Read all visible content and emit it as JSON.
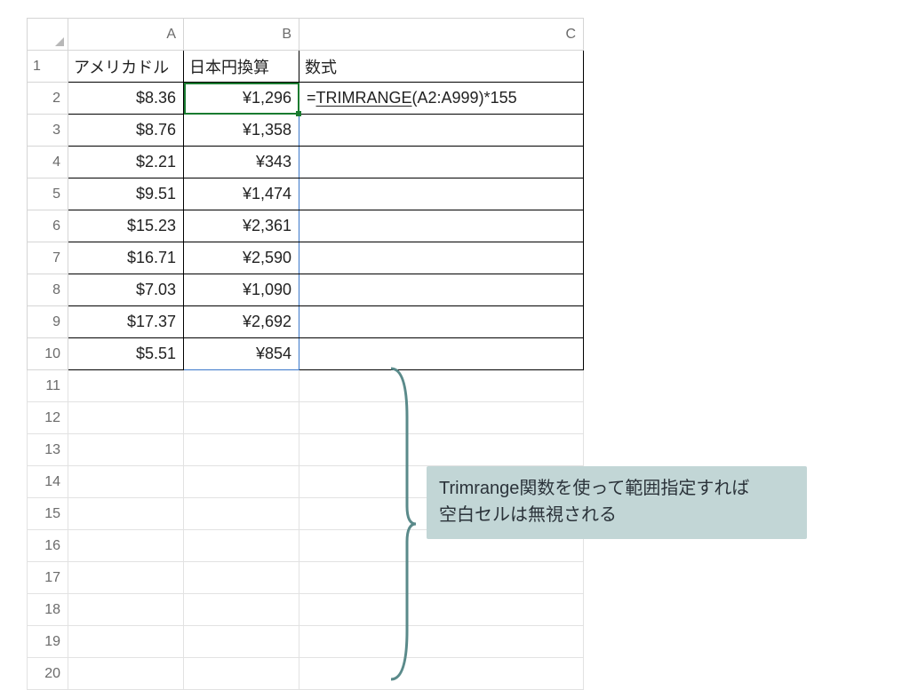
{
  "columns": {
    "A": "A",
    "B": "B",
    "C": "C"
  },
  "rowLabels": [
    "1",
    "2",
    "3",
    "4",
    "5",
    "6",
    "7",
    "8",
    "9",
    "10",
    "11",
    "12",
    "13",
    "14",
    "15",
    "16",
    "17",
    "18",
    "19",
    "20"
  ],
  "header": {
    "A": "アメリカドル",
    "B": "日本円換算",
    "C": "数式"
  },
  "rows": [
    {
      "A": "$8.36",
      "B": "¥1,296"
    },
    {
      "A": "$8.76",
      "B": "¥1,358"
    },
    {
      "A": "$2.21",
      "B": "¥343"
    },
    {
      "A": "$9.51",
      "B": "¥1,474"
    },
    {
      "A": "$15.23",
      "B": "¥2,361"
    },
    {
      "A": "$16.71",
      "B": "¥2,590"
    },
    {
      "A": "$7.03",
      "B": "¥1,090"
    },
    {
      "A": "$17.37",
      "B": "¥2,692"
    },
    {
      "A": "$5.51",
      "B": "¥854"
    }
  ],
  "formula": {
    "eq": "=",
    "fn": "TRIMRANGE",
    "args": "(A2:A999)*155"
  },
  "callout": {
    "line1": "Trimrange関数を使って範囲指定すれば",
    "line2": "空白セルは無視される"
  },
  "chart_data": {
    "type": "table",
    "columns": [
      "アメリカドル",
      "日本円換算",
      "数式"
    ],
    "data": [
      [
        "$8.36",
        "¥1,296",
        "=TRIMRANGE(A2:A999)*155"
      ],
      [
        "$8.76",
        "¥1,358",
        ""
      ],
      [
        "$2.21",
        "¥343",
        ""
      ],
      [
        "$9.51",
        "¥1,474",
        ""
      ],
      [
        "$15.23",
        "¥2,361",
        ""
      ],
      [
        "$16.71",
        "¥2,590",
        ""
      ],
      [
        "$7.03",
        "¥1,090",
        ""
      ],
      [
        "$17.37",
        "¥2,692",
        ""
      ],
      [
        "$5.51",
        "¥854",
        ""
      ]
    ]
  }
}
